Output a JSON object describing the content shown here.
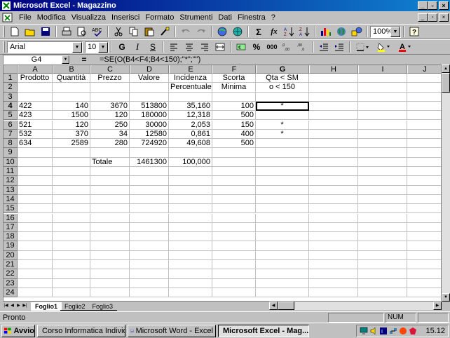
{
  "window": {
    "title": "Microsoft Excel - Magazzino",
    "minimize": "_",
    "restore": "▫",
    "close": "×"
  },
  "menu": [
    "File",
    "Modifica",
    "Visualizza",
    "Inserisci",
    "Formato",
    "Strumenti",
    "Dati",
    "Finestra",
    "?"
  ],
  "toolbar1": {
    "zoom": "100%"
  },
  "toolbar2": {
    "font": "Arial",
    "size": "10",
    "bold": "G",
    "italic": "I",
    "underline": "S",
    "percent": "%",
    "thousands": "000",
    "currency": "€"
  },
  "formula_bar": {
    "cell_ref": "G4",
    "equals": "=",
    "formula": "=SE(O(B4<F4;B4<150);\"*\";\"\")"
  },
  "grid": {
    "columns": [
      "A",
      "B",
      "C",
      "D",
      "E",
      "F",
      "G",
      "H",
      "I",
      "J"
    ],
    "rows": [
      "1",
      "2",
      "3",
      "4",
      "5",
      "6",
      "7",
      "8",
      "9",
      "10",
      "11",
      "12",
      "13",
      "14",
      "15",
      "16",
      "17",
      "18",
      "19",
      "20",
      "21",
      "22",
      "23",
      "24"
    ],
    "cells": [
      {
        "ref": "A1",
        "v": "Prodotto"
      },
      {
        "ref": "B1",
        "v": "Quantità"
      },
      {
        "ref": "C1",
        "v": "Prezzo"
      },
      {
        "ref": "D1",
        "v": "Valore"
      },
      {
        "ref": "E1",
        "v": "Incidenza"
      },
      {
        "ref": "F1",
        "v": "Scorta"
      },
      {
        "ref": "G1",
        "v": "Qta < SM"
      },
      {
        "ref": "E2",
        "v": "Percentuale"
      },
      {
        "ref": "F2",
        "v": "Minima"
      },
      {
        "ref": "G2",
        "v": "o < 150"
      },
      {
        "ref": "A4",
        "v": "422"
      },
      {
        "ref": "B4",
        "v": "140"
      },
      {
        "ref": "C4",
        "v": "3670"
      },
      {
        "ref": "D4",
        "v": "513800"
      },
      {
        "ref": "E4",
        "v": "35,160"
      },
      {
        "ref": "F4",
        "v": "100"
      },
      {
        "ref": "G4",
        "v": "*"
      },
      {
        "ref": "A5",
        "v": "423"
      },
      {
        "ref": "B5",
        "v": "1500"
      },
      {
        "ref": "C5",
        "v": "120"
      },
      {
        "ref": "D5",
        "v": "180000"
      },
      {
        "ref": "E5",
        "v": "12,318"
      },
      {
        "ref": "F5",
        "v": "500"
      },
      {
        "ref": "A6",
        "v": "521"
      },
      {
        "ref": "B6",
        "v": "120"
      },
      {
        "ref": "C6",
        "v": "250"
      },
      {
        "ref": "D6",
        "v": "30000"
      },
      {
        "ref": "E6",
        "v": "2,053"
      },
      {
        "ref": "F6",
        "v": "150"
      },
      {
        "ref": "G6",
        "v": "*"
      },
      {
        "ref": "A7",
        "v": "532"
      },
      {
        "ref": "B7",
        "v": "370"
      },
      {
        "ref": "C7",
        "v": "34"
      },
      {
        "ref": "D7",
        "v": "12580"
      },
      {
        "ref": "E7",
        "v": "0,861"
      },
      {
        "ref": "F7",
        "v": "400"
      },
      {
        "ref": "G7",
        "v": "*"
      },
      {
        "ref": "A8",
        "v": "634"
      },
      {
        "ref": "B8",
        "v": "2589"
      },
      {
        "ref": "C8",
        "v": "280"
      },
      {
        "ref": "D8",
        "v": "724920"
      },
      {
        "ref": "E8",
        "v": "49,608"
      },
      {
        "ref": "F8",
        "v": "500"
      },
      {
        "ref": "C10",
        "v": "Totale"
      },
      {
        "ref": "D10",
        "v": "1461300"
      },
      {
        "ref": "E10",
        "v": "100,000"
      }
    ],
    "active_cell": "G4"
  },
  "sheets": [
    "Foglio1",
    "Foglio2",
    "Foglio3"
  ],
  "active_sheet": "Foglio1",
  "status": {
    "text": "Pronto",
    "num": "NUM"
  },
  "taskbar": {
    "start": "Avvio",
    "tasks": [
      {
        "label": "Corso Informatica Individuale",
        "active": false
      },
      {
        "label": "Microsoft Word - Excel",
        "active": false
      },
      {
        "label": "Microsoft Excel - Mag...",
        "active": true
      }
    ],
    "clock": "15.12"
  },
  "colors": {
    "title_start": "#000080",
    "title_end": "#1084d0",
    "face": "#c0c0c0",
    "desktop": "#008080"
  }
}
